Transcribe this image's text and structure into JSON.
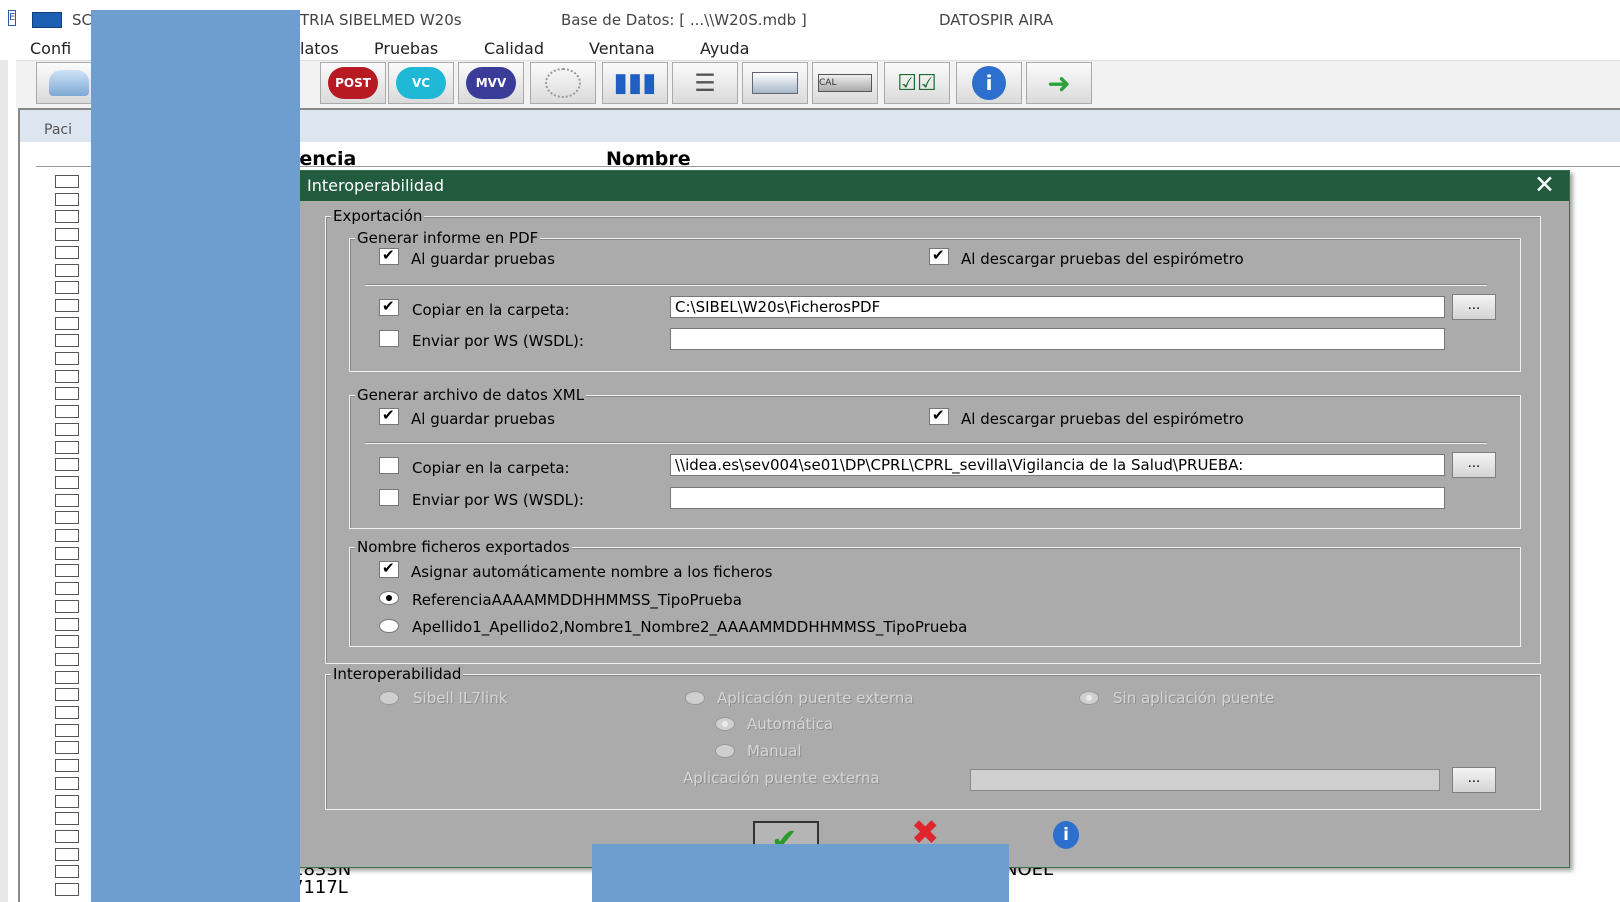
{
  "window": {
    "title_left": "SC",
    "title_right": "TRIA SIBELMED W20s",
    "database": "Base de Datos:  [ ...\\\\W20S.mdb ]",
    "datospir": "DATOSPIR AIRA"
  },
  "menu": [
    "Confi",
    "latos",
    "Pruebas",
    "Calidad",
    "Ventana",
    "Ayuda"
  ],
  "toolbar": {
    "post_label": "POST",
    "vc_label": "VC",
    "mvv_label": "MVV",
    "cal_label": "CAL"
  },
  "table": {
    "tab_label": "Paci",
    "col_referencia": "rencia",
    "col_nombre": "Nombre",
    "visible_refs": [
      "1833N",
      "7117L"
    ],
    "visible_name_fragment": "NOEL"
  },
  "dialog": {
    "title": "Interoperabilidad",
    "close": "✕",
    "export_group": "Exportación",
    "pdf": {
      "group": "Generar informe en PDF",
      "on_save": "Al guardar pruebas",
      "on_download": "Al descargar pruebas del espirómetro",
      "copy_folder_label": "Copiar en la carpeta:",
      "copy_folder_value": "C:\\SIBEL\\W20s\\FicherosPDF",
      "send_ws_label": "Enviar por WS (WSDL):",
      "send_ws_value": "",
      "browse": "..."
    },
    "xml": {
      "group": "Generar archivo de datos XML",
      "on_save": "Al guardar pruebas",
      "on_download": "Al descargar pruebas del espirómetro",
      "copy_folder_label": "Copiar en la carpeta:",
      "copy_folder_value": "\\\\idea.es\\sev004\\se01\\DP\\CPRL\\CPRL_sevilla\\Vigilancia de la Salud\\PRUEBA:",
      "send_ws_label": "Enviar por WS (WSDL):",
      "send_ws_value": "",
      "browse": "..."
    },
    "names": {
      "group": "Nombre ficheros exportados",
      "auto_name": "Asignar automáticamente nombre a los ficheros",
      "opt1": "ReferenciaAAAAMMDDHHMMSS_TipoPrueba",
      "opt2": "Apellido1_Apellido2,Nombre1_Nombre2_AAAAMMDDHHMMSS_TipoPrueba"
    },
    "interop": {
      "group": "Interoperabilidad",
      "sibel": "Sibell IL7link",
      "external": "Aplicación puente externa",
      "none": "Sin aplicación puente",
      "auto": "Automática",
      "manual": "Manual",
      "ext_app_label": "Aplicación puente externa",
      "ext_app_value": "",
      "browse": "..."
    }
  },
  "colors": {
    "dialog_title_bg": "#235b3e",
    "dialog_bg": "#ababab",
    "redaction": "#6e9dd0"
  }
}
